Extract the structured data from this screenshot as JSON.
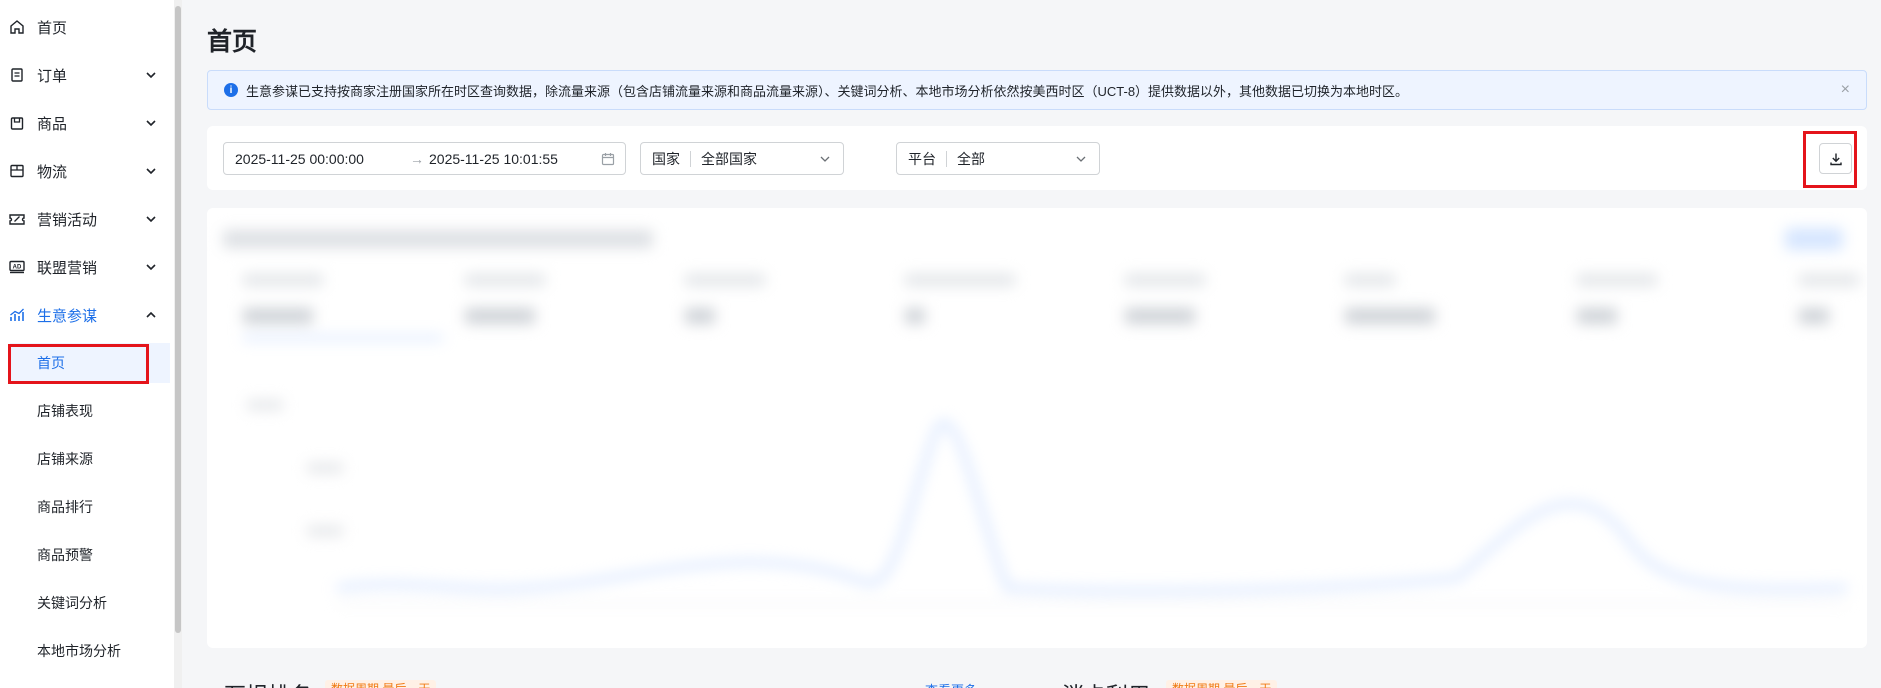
{
  "sidebar": {
    "items": [
      {
        "label": "首页",
        "icon": "home-icon"
      },
      {
        "label": "订单",
        "icon": "order-icon"
      },
      {
        "label": "商品",
        "icon": "product-icon"
      },
      {
        "label": "物流",
        "icon": "logistics-icon"
      },
      {
        "label": "营销活动",
        "icon": "ticket-icon"
      },
      {
        "label": "联盟营销",
        "icon": "ad-icon"
      },
      {
        "label": "生意参谋",
        "icon": "analytics-icon"
      }
    ],
    "subitems": [
      {
        "label": "首页"
      },
      {
        "label": "店铺表现"
      },
      {
        "label": "店铺来源"
      },
      {
        "label": "商品排行"
      },
      {
        "label": "商品预警"
      },
      {
        "label": "关键词分析"
      },
      {
        "label": "本地市场分析"
      }
    ]
  },
  "page": {
    "title": "首页"
  },
  "notice": {
    "text": "生意参谋已支持按商家注册国家所在时区查询数据，除流量来源（包含店铺流量来源和商品流量来源）、关键词分析、本地市场分析依然按美西时区（UCT-8）提供数据以外，其他数据已切换为本地时区。",
    "close": "×"
  },
  "filters": {
    "date_start": "2025-11-25 00:00:00",
    "date_arrow": "→",
    "date_end": "2025-11-25 10:01:55",
    "country_prefix": "国家",
    "country_value": "全部国家",
    "platform_prefix": "平台",
    "platform_value": "全部"
  },
  "bottom": {
    "left_title": "万坦排名",
    "left_pill": "数据周期 最后一天",
    "link": "查看更多",
    "right_title": "消卡利用",
    "right_pill": "数据周期 最后一天"
  },
  "colors": {
    "accent": "#1d6fe8",
    "highlight": "#e4141b"
  }
}
